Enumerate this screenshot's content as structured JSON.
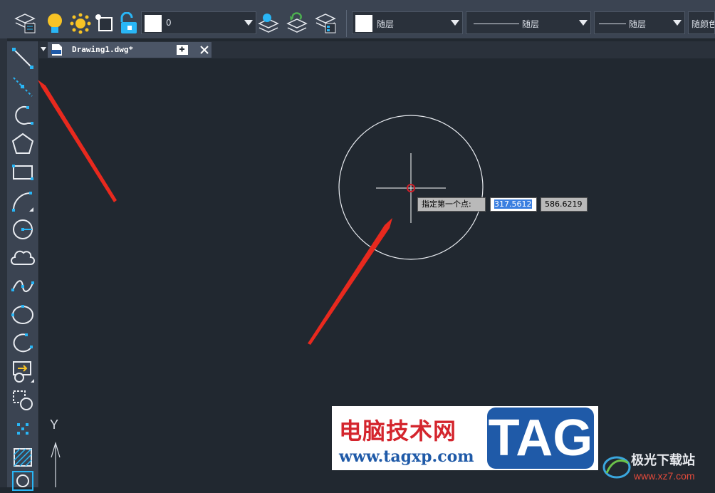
{
  "toolbar": {
    "layer_combo_value": "0",
    "color_combo_value": "随层",
    "linetype_combo_value": "随层",
    "lineweight_combo_value": "随层",
    "plotstyle_combo_value": "随颜色"
  },
  "document_tab": {
    "label": "Drawing1.dwg*"
  },
  "command_tooltip": {
    "prompt": "指定第一个点:",
    "x_value": "317.5612",
    "y_value": "586.6219"
  },
  "ucs": {
    "y_label": "Y"
  },
  "watermark": {
    "title": "电脑技术网",
    "url": "www.tagxp.com",
    "logo_text": "TAG"
  },
  "corner_watermark": {
    "title": "极光下载站",
    "url": "www.xz7.com"
  },
  "colors": {
    "canvas_bg": "#212830",
    "toolbar_bg": "#3b4452",
    "icon_accent": "#29b6f6",
    "highlight_yellow": "#f7c325",
    "arrow_red": "#e8291e"
  }
}
